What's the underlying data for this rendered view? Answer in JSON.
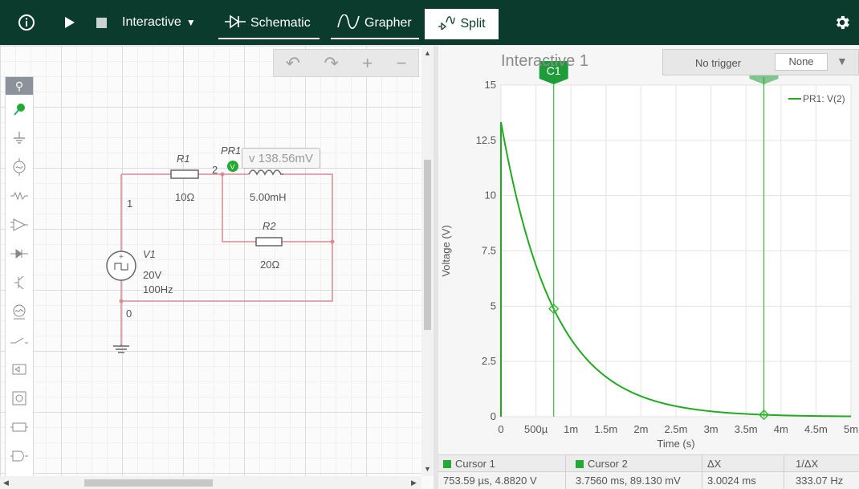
{
  "toolbar": {
    "info_icon": "info-icon",
    "mode_label": "Interactive",
    "tab_schematic": "Schematic",
    "tab_grapher": "Grapher",
    "tab_split": "Split",
    "settings_icon": "gear-icon"
  },
  "schematic": {
    "r1_name": "R1",
    "r1_value": "10Ω",
    "r2_name": "R2",
    "r2_value": "20Ω",
    "l_value": "5.00mH",
    "v1_name": "V1",
    "v1_amp": "20V",
    "v1_freq": "100Hz",
    "node1": "1",
    "node2": "2",
    "node0": "0",
    "probe_name": "PR1",
    "probe_reading": "v 138.56mV"
  },
  "graph": {
    "title": "Interactive 1",
    "trigger_label": "No trigger",
    "trigger_select": "None",
    "legend": "PR1: V(2)",
    "colors": {
      "trace": "#22aa22",
      "cursor": "#3cba3c"
    }
  },
  "chart_data": {
    "type": "line",
    "title": "Interactive 1",
    "xlabel": "Time (s)",
    "ylabel": "Voltage (V)",
    "xlim": [
      0,
      0.005
    ],
    "ylim": [
      0,
      15
    ],
    "x_ticks": [
      "0",
      "500µ",
      "1m",
      "1.5m",
      "2m",
      "2.5m",
      "3m",
      "3.5m",
      "4m",
      "4.5m",
      "5m"
    ],
    "y_ticks": [
      "0",
      "2.5",
      "5",
      "7.5",
      "10",
      "12.5",
      "15"
    ],
    "grid": true,
    "legend_position": "top-right",
    "series": [
      {
        "name": "PR1: V(2)",
        "x": [
          0,
          0.00025,
          0.0005,
          0.00075,
          0.001,
          0.00125,
          0.0015,
          0.002,
          0.0025,
          0.003,
          0.0035,
          0.004,
          0.0045,
          0.005
        ],
        "y": [
          13.33,
          9.83,
          6.91,
          4.88,
          3.45,
          2.44,
          1.72,
          0.86,
          0.43,
          0.21,
          0.11,
          0.06,
          0.03,
          0.02
        ]
      }
    ],
    "cursors": [
      {
        "name": "C1",
        "x": 0.00075359,
        "y": 4.882
      },
      {
        "name": "C2",
        "x": 0.003756,
        "y": 0.08913
      }
    ]
  },
  "cursor_table": {
    "headers": [
      "Cursor 1",
      "Cursor 2",
      "ΔX",
      "1/ΔX"
    ],
    "values": [
      "753.59 µs, 4.8820 V",
      "3.7560 ms, 89.130 mV",
      "3.0024 ms",
      "333.07 Hz"
    ]
  }
}
